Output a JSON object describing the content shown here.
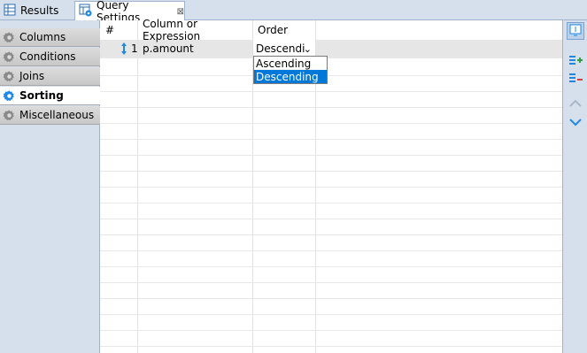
{
  "tabs": {
    "results": {
      "label": "Results",
      "icon": "table-icon"
    },
    "query_settings": {
      "label": "Query Settings",
      "icon": "query-settings-icon",
      "close": "⊠"
    }
  },
  "sidebar": {
    "items": [
      {
        "label": "Columns",
        "active": false
      },
      {
        "label": "Conditions",
        "active": false
      },
      {
        "label": "Joins",
        "active": false
      },
      {
        "label": "Sorting",
        "active": true
      },
      {
        "label": "Miscellaneous",
        "active": false
      }
    ]
  },
  "grid": {
    "headers": [
      "#",
      "Column or Expression",
      "Order"
    ],
    "rows": [
      {
        "index": "1",
        "column": "p.amount",
        "order": "Descendi"
      }
    ],
    "combo_arrow": "⌄"
  },
  "dropdown": {
    "options": [
      "Ascending",
      "Descending"
    ],
    "selected": "Descending"
  },
  "toolbar": {
    "buttons": [
      "panel-toggle-icon",
      "add-sort-icon",
      "remove-sort-icon",
      "move-up-icon",
      "move-down-icon"
    ]
  },
  "colors": {
    "accent": "#0078d7",
    "panel_bg": "#d6e0ec",
    "icon_blue": "#1e88e5",
    "add_green": "#2e9e3e",
    "remove_red": "#e53935"
  }
}
